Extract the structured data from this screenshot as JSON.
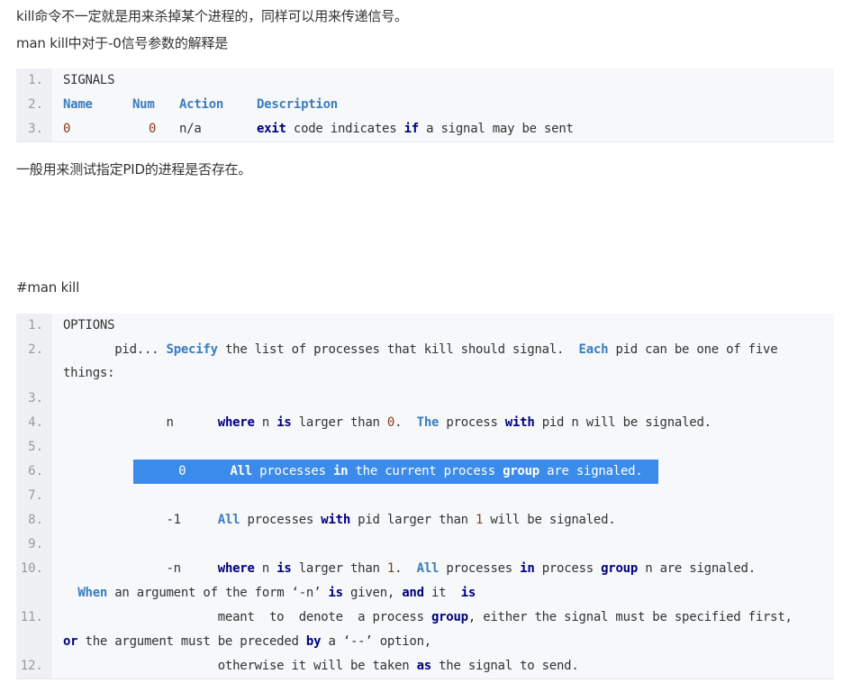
{
  "intro": {
    "line1": "kill命令不一定就是用来杀掉某个进程的，同样可以用来传递信号。",
    "line2": "man kill中对于-0信号参数的解释是"
  },
  "signals_block": {
    "line_numbers": [
      "1.",
      "2.",
      "3."
    ],
    "lines": [
      {
        "text": "SIGNALS"
      },
      {
        "name": "Name",
        "num": "Num",
        "action": "Action",
        "description": "Description"
      },
      {
        "name": "0",
        "num": "0",
        "action": "n/a",
        "w1": "exit",
        "t1": " code indicates ",
        "w2": "if",
        "t2": " a signal may be sent"
      }
    ]
  },
  "middle_text": "一般用来测试指定PID的进程是否存在。",
  "man_heading": "#man kill",
  "options_block": {
    "line_numbers": [
      "1.",
      "2.",
      "3.",
      "4.",
      "5.",
      "6.",
      "7.",
      "8.",
      "9.",
      "10.",
      "11.",
      "12."
    ],
    "l1": "OPTIONS",
    "l2": {
      "a": "       pid... ",
      "b": "Specify",
      "c": " the list of processes that kill should signal.  ",
      "d": "Each",
      "e": " pid can be one of five"
    },
    "l2b": "things:",
    "l4": {
      "a": "              n      ",
      "b": "where",
      "c": " n ",
      "d": "is",
      "e": " larger than ",
      "f": "0",
      "g": ".  ",
      "h": "The",
      "i": " process ",
      "j": "with",
      "k": " pid n will be signaled."
    },
    "l6": {
      "a": " 0      ",
      "b": "All",
      "c": " processes ",
      "d": "in",
      "e": " the current process ",
      "f": "group",
      "g": " are signaled."
    },
    "l8": {
      "a": "              -1     ",
      "b": "All",
      "c": " processes ",
      "d": "with",
      "e": " pid larger than ",
      "f": "1",
      "g": " will be signaled."
    },
    "l10": {
      "a": "              -n     ",
      "b": "where",
      "c": " n ",
      "d": "is",
      "e": " larger than ",
      "f": "1",
      "g": ".  ",
      "h": "All",
      "i": " processes ",
      "j": "in",
      "k": " process ",
      "l": "group",
      "m": " n are signaled."
    },
    "l10b": {
      "a": "  ",
      "b": "When",
      "c": " an argument of the form ‘-n’ ",
      "d": "is",
      "e": " given, ",
      "f": "and",
      "g": " it  ",
      "h": "is"
    },
    "l11": {
      "a": "                     meant  to  denote  a process ",
      "b": "group",
      "c": ", either the signal must be specified first,"
    },
    "l11b": {
      "a": "or",
      "b": " the argument must be preceded ",
      "c": "by",
      "d": " a ‘--’ option,"
    },
    "l12": {
      "a": "                     otherwise it will be taken ",
      "b": "as",
      "c": " the signal to send."
    }
  },
  "colors": {
    "code_background": "#f6f8fa",
    "keyword": "#000080",
    "highlight": "#3a7dc0",
    "selection": "#3b8bea"
  }
}
